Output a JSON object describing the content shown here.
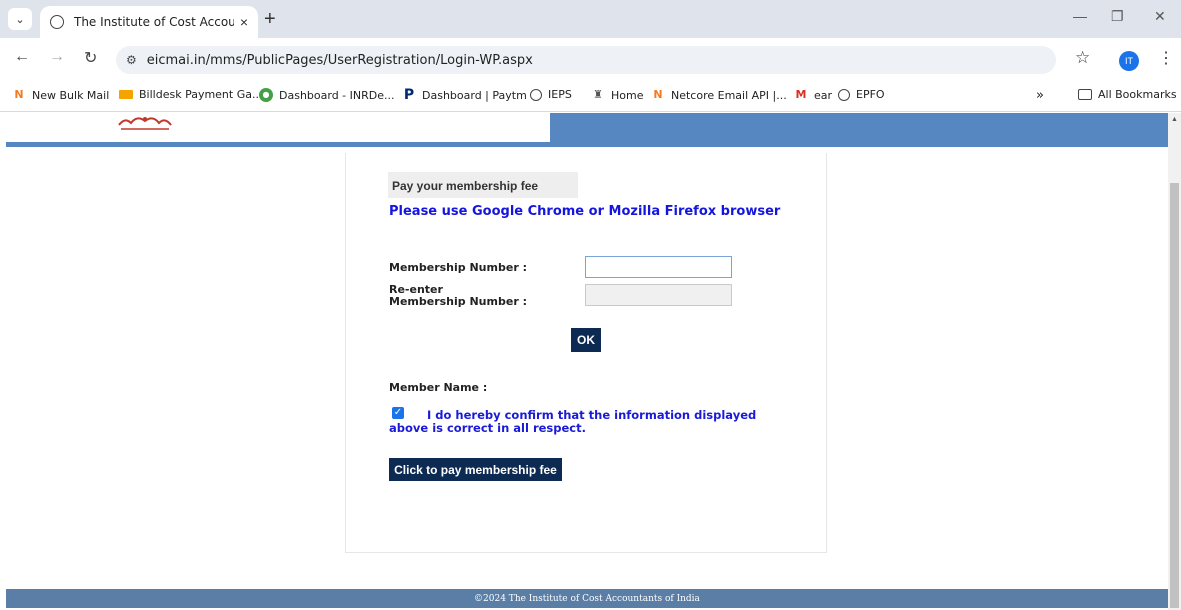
{
  "browser": {
    "tab_title": "The Institute of Cost Accountan",
    "tab_close": "×",
    "new_tab": "+",
    "url": "eicmai.in/mms/PublicPages/UserRegistration/Login-WP.aspx",
    "profile_initials": "IT",
    "bookmarks": [
      {
        "label": "New Bulk Mail",
        "icon": "netcore-icon"
      },
      {
        "label": "Billdesk Payment Ga...",
        "icon": "billdesk-icon"
      },
      {
        "label": "Dashboard - INRDe...",
        "icon": "inrdeals-icon"
      },
      {
        "label": "Dashboard | Paytm",
        "icon": "paytm-icon"
      },
      {
        "label": "IEPS",
        "icon": "globe-icon"
      },
      {
        "label": "Home",
        "icon": "emblem-icon"
      },
      {
        "label": "Netcore Email API |...",
        "icon": "netcore-icon"
      },
      {
        "label": "ear",
        "icon": "gmail-icon"
      },
      {
        "label": "EPFO",
        "icon": "globe-icon"
      }
    ],
    "bookmarks_overflow": "»",
    "all_bookmarks": "All Bookmarks"
  },
  "page": {
    "pay_tag": "Pay your membership fee",
    "browser_note": "Please use Google Chrome or Mozilla Firefox browser",
    "membership_number_label": "Membership Number :",
    "reenter_label_1": "Re-enter",
    "reenter_label_2": "Membership Number :",
    "membership_number_value": "",
    "reenter_value": "",
    "ok_label": "OK",
    "member_name_label": "Member Name :",
    "confirm_checked": true,
    "confirm_text": "I do hereby confirm that the information displayed above is correct in all respect.",
    "pay_button_label": "Click to pay membership fee",
    "footer_text": "©2024 The Institute of Cost Accountants of India"
  },
  "colors": {
    "header_blue": "#5687c0",
    "footer_blue": "#5a7ea5",
    "button_navy": "#0d2a52",
    "link_blue": "#1515e0"
  }
}
